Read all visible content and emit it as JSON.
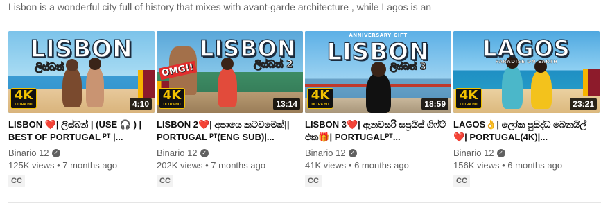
{
  "description": "Lisbon is a wonderful city full of history that mixes with avant-garde architecture , while Lagos is an",
  "videos": [
    {
      "thumb_title": "LISBON",
      "thumb_sub": "ලිස්බන්",
      "badge": "4K",
      "badge_sub": "ULTRA HD",
      "duration": "4:10",
      "title": "LISBON ❤️| ලිස්බන් | (USE 🎧 ) | BEST OF PORTUGAL ᴾᵀ |...",
      "channel": "Binario 12",
      "views": "125K views",
      "age": "7 months ago",
      "cc": "CC"
    },
    {
      "thumb_title": "LISBON",
      "thumb_sub": "ලිස්බන් 2",
      "thumb_tag": "OMG!!",
      "badge": "4K",
      "badge_sub": "ULTRA HD",
      "duration": "13:14",
      "title": "LISBON 2❤️| අපායෙ කටවමෙක්|| PORTUGAL ᴾᵀ(ENG SUB)|...",
      "channel": "Binario 12",
      "views": "202K views",
      "age": "7 months ago",
      "cc": "CC"
    },
    {
      "thumb_kicker": "ANNIVERSARY GIFT",
      "thumb_title": "LISBON",
      "thumb_sub": "ලිස්බන් 3",
      "badge": "4K",
      "badge_sub": "ULTRA HD",
      "duration": "18:59",
      "title": "LISBON 3❤️| ඇනවසරි සප්‍රයිස් ගිෆ්ට් එක🎁| PORTUGALᴾᵀ...",
      "channel": "Binario 12",
      "views": "41K views",
      "age": "6 months ago",
      "cc": "CC"
    },
    {
      "thumb_title": "LAGOS",
      "thumb_kicker": "PARADISE ON EARTH",
      "badge": "4K",
      "badge_sub": "ULTRA HD",
      "duration": "23:21",
      "title": "LAGOS👌| ලෝක පුසිද්ධ බෙනයිල්❤️| PORTUGAL(4K)|...",
      "channel": "Binario 12",
      "views": "156K views",
      "age": "6 months ago",
      "cc": "CC"
    }
  ],
  "meta_separator": "•",
  "verified_glyph": "✓",
  "colors": {
    "badge_yellow": "#f2c200",
    "sky": "#6fb8e3",
    "sea": "#2d8fc9",
    "sand": "#e7c89a",
    "flag_maroon": "#8d1b2b",
    "flag_yellow": "#f6b400"
  }
}
